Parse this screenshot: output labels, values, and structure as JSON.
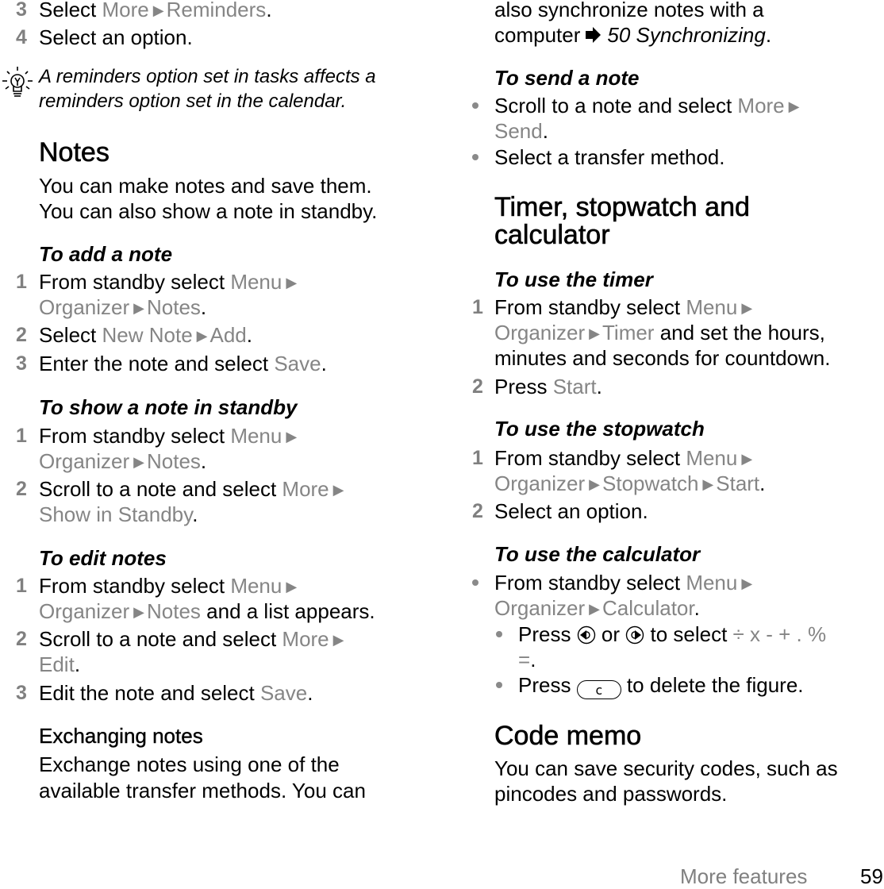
{
  "left_column": {
    "steps_top": [
      {
        "num": "3",
        "pre": "Select ",
        "path": [
          "More",
          "Reminders"
        ],
        "post": "."
      },
      {
        "num": "4",
        "text": "Select an option."
      }
    ],
    "tip": {
      "icon": "lightbulb-icon",
      "lines": [
        "A reminders option set in tasks affects a",
        "reminders option set in the calendar."
      ]
    },
    "notes_heading": "Notes",
    "notes_intro": [
      "You can make notes and save them.",
      "You can also show a note in standby."
    ],
    "add_note": {
      "title": "To add a note",
      "step1_line1": "From standby select ",
      "step1_menu": "Menu",
      "step1_line2_path": [
        "Organizer",
        "Notes"
      ],
      "step2_pre": "Select ",
      "step2_path": [
        "New Note",
        "Add"
      ],
      "step3_pre": "Enter the note and select ",
      "step3_action": "Save"
    },
    "show_note": {
      "title": "To show a note in standby",
      "step1_line1": "From standby select ",
      "step1_menu": "Menu",
      "step1_line2_path": [
        "Organizer",
        "Notes"
      ],
      "step2_pre": "Scroll to a note and select ",
      "step2_more": "More",
      "step2_line2": "Show in Standby"
    },
    "edit_notes": {
      "title": "To edit notes",
      "step1_line1": "From standby select ",
      "step1_menu": "Menu",
      "step1_line2_path": [
        "Organizer",
        "Notes"
      ],
      "step1_line2_post": " and a list appears.",
      "step2_pre": "Scroll to a note and select ",
      "step2_more": "More",
      "step2_line2": "Edit",
      "step3_pre": "Edit the note and select ",
      "step3_action": "Save"
    },
    "exchanging": {
      "heading": "Exchanging notes",
      "lines": [
        "Exchange notes using one of the",
        "available transfer methods. You can"
      ]
    }
  },
  "right_column": {
    "exchanging_cont": {
      "line1": "also synchronize notes with a",
      "line2_pre": "computer",
      "ref_icon": "arrow-right-icon",
      "ref_text": "50 Synchronizing",
      "line2_post": "."
    },
    "send_note": {
      "title": "To send a note",
      "bullet1_pre": "Scroll to a note and select ",
      "bullet1_more": "More",
      "bullet1_line2": "Send",
      "bullet2": "Select a transfer method."
    },
    "timer_heading": [
      "Timer, stopwatch and",
      "calculator"
    ],
    "timer": {
      "title": "To use the timer",
      "step1_line1": "From standby select ",
      "step1_menu": "Menu",
      "step1_line2_path": [
        "Organizer",
        "Timer"
      ],
      "step1_line2_post": " and set the hours,",
      "step1_line3": "minutes and seconds for countdown.",
      "step2_pre": "Press ",
      "step2_action": "Start"
    },
    "stopwatch": {
      "title": "To use the stopwatch",
      "step1_line1": "From standby select ",
      "step1_menu": "Menu",
      "step1_line2_path": [
        "Organizer",
        "Stopwatch",
        "Start"
      ],
      "step2": "Select an option."
    },
    "calculator": {
      "title": "To use the calculator",
      "bullet1_line1": "From standby select ",
      "bullet1_menu": "Menu",
      "bullet1_line2_path": [
        "Organizer",
        "Calculator"
      ],
      "sub1_pre": "Press ",
      "sub1_or": " or ",
      "sub1_mid": " to select ",
      "sub1_ops": "÷ x - + . %",
      "sub1_line2": "=",
      "sub2_pre": "Press ",
      "sub2_key": "c",
      "sub2_post": " to delete the figure."
    },
    "code_memo": {
      "heading": "Code memo",
      "lines": [
        "You can save security codes, such as",
        "pincodes and passwords."
      ]
    }
  },
  "footer": {
    "section": "More features",
    "page": "59"
  },
  "colors": {
    "text": "#000000",
    "menu_gray": "#858585",
    "number_gray": "#808080"
  }
}
